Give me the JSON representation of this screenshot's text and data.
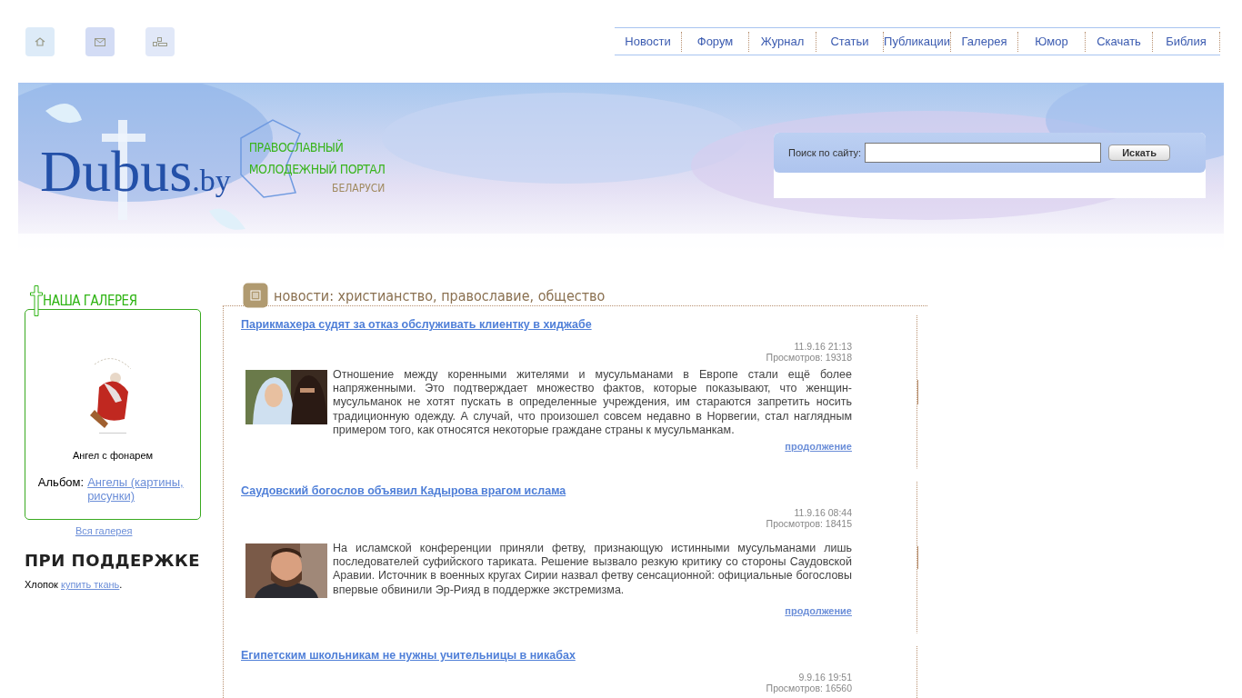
{
  "top_icons": [
    {
      "kind": "home"
    },
    {
      "kind": "mail"
    },
    {
      "kind": "sitemap"
    }
  ],
  "nav": [
    {
      "label": "Новости"
    },
    {
      "label": "Форум"
    },
    {
      "label": "Журнал"
    },
    {
      "label": "Статьи"
    },
    {
      "label": "Публикации"
    },
    {
      "label": "Галерея"
    },
    {
      "label": "Юмор"
    },
    {
      "label": "Скачать"
    },
    {
      "label": "Библия"
    }
  ],
  "banner": {
    "logo_main": "Dubus",
    "logo_domain": ".by",
    "tagline_1": "ПРАВОСЛАВНЫЙ",
    "tagline_2": "МОЛОДЕЖНЫЙ ПОРТАЛ",
    "tagline_3": "БЕЛАРУСИ"
  },
  "search": {
    "label": "Поиск по сайту:",
    "button": "Искать"
  },
  "gallery": {
    "title": "НАША ГАЛЕРЕЯ",
    "caption": "Ангел с фонарем",
    "album_label": "Альбом:",
    "album_link": "Ангелы (картины, рисунки)",
    "all_link": "Вся галерея"
  },
  "support": {
    "title": "ПРИ ПОДДЕРЖКЕ",
    "text_before": "Хлопок",
    "link": "купить ткань",
    "text_after": "."
  },
  "news": {
    "title": "новости: христианство, православие, общество",
    "items": [
      {
        "title": "Парикмахера судят за отказ обслуживать клиентку в хиджабе",
        "date": "11.9.16 21:13",
        "views": "Просмотров: 19318",
        "text": "Отношение между коренными жителями и мусульманами в Европе стали ещё более напряженными. Это подтверждает множество фактов, которые показывают, что женщин-мусульманок не хотят пускать в определенные учреждения, им стараются запретить носить традиционную одежду. А случай, что произошел совсем недавно в Норвегии, стал наглядным примером того, как относятся некоторые граждане страны к мусульманкам.",
        "more": "продолжение"
      },
      {
        "title": "Саудовский богослов объявил Кадырова врагом ислама",
        "date": "11.9.16 08:44",
        "views": "Просмотров: 18415",
        "text": "На исламской конференции приняли фетву, признающую истинными мусульманами лишь последователей суфийского тариката. Решение вызвало резкую критику со стороны Саудовской Аравии. Источник в военных кругах Сирии назвал фетву сенсационной: официальные богословы впервые обвинили Эр-Рияд в поддержке экстремизма.",
        "more": "продолжение"
      },
      {
        "title": "Египетским школьникам не нужны учительницы в никабах",
        "date": "9.9.16 19:51",
        "views": "Просмотров: 16560"
      }
    ]
  }
}
